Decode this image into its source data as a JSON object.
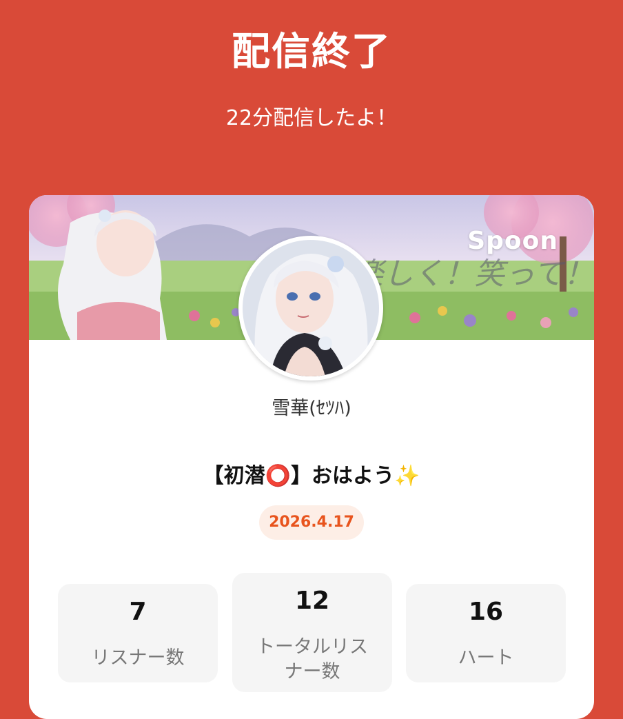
{
  "header": {
    "title": "配信終了",
    "subtitle": "22分配信したよ！"
  },
  "banner": {
    "logo_text": "Spoon",
    "slogan": "楽しく！笑って！"
  },
  "profile": {
    "username": "雪華(ｾﾂﾊ)"
  },
  "live": {
    "title": "【初潜⭕】おはよう✨",
    "date": "2026.4.17"
  },
  "stats": [
    {
      "value": "7",
      "label": "リスナー数"
    },
    {
      "value": "12",
      "label_line1": "トータルリス",
      "label_line2": "ナー数"
    },
    {
      "value": "16",
      "label": "ハート"
    }
  ],
  "colors": {
    "background": "#d94a38",
    "accent": "#e8541d",
    "badge_bg": "#fdeee6"
  }
}
